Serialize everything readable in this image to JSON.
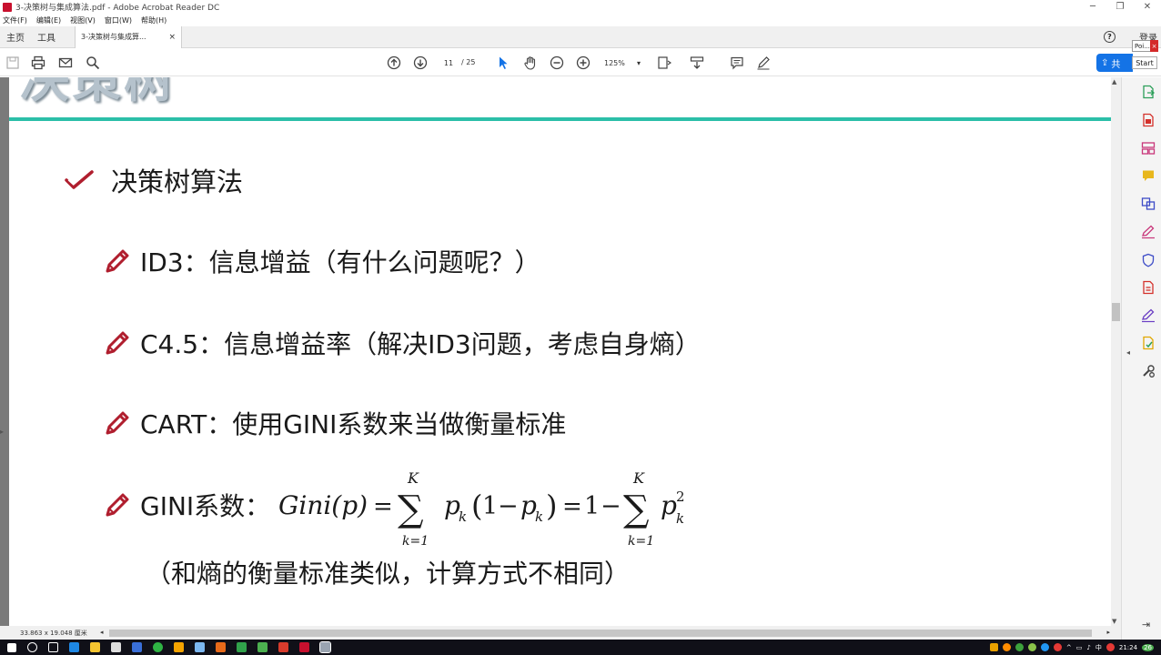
{
  "window": {
    "title": "3-决策树与集成算法.pdf - Adobe Acrobat Reader DC",
    "minimize": "─",
    "maximize": "❐",
    "close": "✕"
  },
  "menu": [
    "文件(F)",
    "编辑(E)",
    "视图(V)",
    "窗口(W)",
    "帮助(H)"
  ],
  "tabs": {
    "home": "主页",
    "tools": "工具",
    "document": "3-决策树与集成算...",
    "close": "×",
    "signin": "登录",
    "help": "?"
  },
  "overlay": {
    "poi": "Poi...",
    "poi_close": "×",
    "start": "Start"
  },
  "toolbar": {
    "page_current": "11",
    "page_total": "/ 25",
    "zoom": "125%",
    "zoom_arrow": "▾",
    "share_label": "共"
  },
  "slide": {
    "title": "决策树",
    "heading": "决策树算法",
    "bullets": [
      "ID3：信息增益（有什么问题呢？）",
      "C4.5：信息增益率（解决ID3问题，考虑自身熵）",
      "CART：使用GINI系数来当做衡量标准",
      "GINI系数："
    ],
    "formula": {
      "lhs": "Gini(p)",
      "eq1": "=",
      "sum_top_1": "K",
      "sum_bottom_1": "k=1",
      "term1": "p",
      "sub1": "k",
      "paren_open": "(",
      "one": "1",
      "minus": "−",
      "term2": "p",
      "sub2": "k",
      "paren_close": ")",
      "eq2": "=",
      "one2": "1",
      "minus2": "−",
      "sum_top_2": "K",
      "sum_bottom_2": "k=1",
      "term3": "p",
      "sub3": "k",
      "sup3": "2",
      "sigma": "∑"
    },
    "note": "（和熵的衡量标准类似，计算方式不相同）"
  },
  "statusbar": {
    "dimensions": "33.863 x 19.048 厘米"
  },
  "taskbar": {
    "time": "21:24",
    "lang": "中",
    "badge": "26"
  },
  "colors": {
    "accent_teal": "#2bbfa8",
    "acrobat_red": "#c8102e",
    "share_blue": "#1473e6",
    "mark_red": "#b01e2e"
  }
}
